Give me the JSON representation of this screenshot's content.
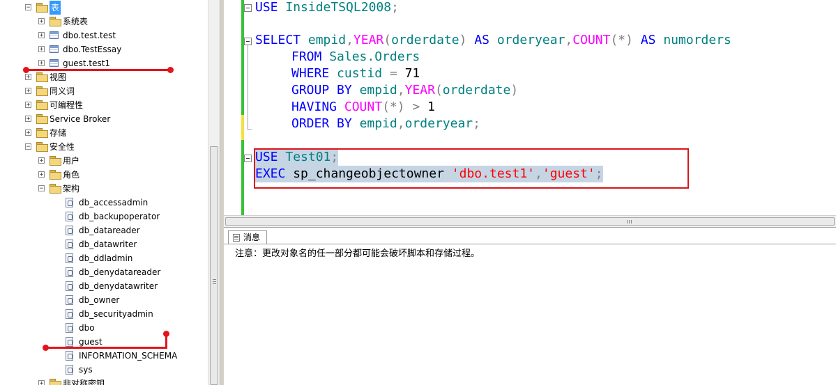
{
  "tree": {
    "items": [
      {
        "label": "表",
        "icon": "folder-icon",
        "expander": "−",
        "selected": true
      },
      {
        "label": "系统表",
        "icon": "folder-icon",
        "expander": "+"
      },
      {
        "label": "dbo.test.test",
        "icon": "table-icon",
        "expander": "+"
      },
      {
        "label": "dbo.TestEssay",
        "icon": "table-icon",
        "expander": "+"
      },
      {
        "label": "guest.test1",
        "icon": "table-icon",
        "expander": "+"
      },
      {
        "label": "视图",
        "icon": "folder-icon",
        "expander": "+"
      },
      {
        "label": "同义词",
        "icon": "folder-icon",
        "expander": "+"
      },
      {
        "label": "可编程性",
        "icon": "folder-icon",
        "expander": "+"
      },
      {
        "label": "Service Broker",
        "icon": "folder-icon",
        "expander": "+"
      },
      {
        "label": "存储",
        "icon": "folder-icon",
        "expander": "+"
      },
      {
        "label": "安全性",
        "icon": "folder-icon",
        "expander": "−"
      },
      {
        "label": "用户",
        "icon": "folder-icon",
        "expander": "+"
      },
      {
        "label": "角色",
        "icon": "folder-icon",
        "expander": "+"
      },
      {
        "label": "架构",
        "icon": "folder-icon",
        "expander": "−"
      },
      {
        "label": "db_accessadmin",
        "icon": "schema-icon"
      },
      {
        "label": "db_backupoperator",
        "icon": "schema-icon"
      },
      {
        "label": "db_datareader",
        "icon": "schema-icon"
      },
      {
        "label": "db_datawriter",
        "icon": "schema-icon"
      },
      {
        "label": "db_ddladmin",
        "icon": "schema-icon"
      },
      {
        "label": "db_denydatareader",
        "icon": "schema-icon"
      },
      {
        "label": "db_denydatawriter",
        "icon": "schema-icon"
      },
      {
        "label": "db_owner",
        "icon": "schema-icon"
      },
      {
        "label": "db_securityadmin",
        "icon": "schema-icon"
      },
      {
        "label": "dbo",
        "icon": "schema-icon"
      },
      {
        "label": "guest",
        "icon": "schema-icon"
      },
      {
        "label": "INFORMATION_SCHEMA",
        "icon": "schema-icon"
      },
      {
        "label": "sys",
        "icon": "schema-icon"
      },
      {
        "label": "非对称密钥",
        "icon": "folder-icon",
        "expander": "+"
      }
    ]
  },
  "editor": {
    "line1": {
      "kw": "USE",
      "db": "InsideTSQL2008",
      "end": ";"
    },
    "line2": {
      "select": "SELECT",
      "c1": "empid",
      "comma": ",",
      "year": "YEAR",
      "lp": "(",
      "c2": "orderdate",
      "rp": ")",
      "as": "AS",
      "a1": "orderyear",
      "count": "COUNT",
      "star": "(*)",
      "a2": "numorders"
    },
    "line3": {
      "from": "FROM",
      "table": "Sales.Orders"
    },
    "line4": {
      "where": "WHERE",
      "col": "custid",
      "eq": "=",
      "val": "71"
    },
    "line5": {
      "group": "GROUP",
      "by": "BY",
      "c1": "empid",
      "comma": ",",
      "year": "YEAR",
      "lp": "(",
      "c2": "orderdate",
      "rp": ")"
    },
    "line6": {
      "having": "HAVING",
      "count": "COUNT",
      "star": "(*)",
      "gt": ">",
      "val": "1"
    },
    "line7": {
      "order": "ORDER",
      "by": "BY",
      "c1": "empid",
      "comma": ",",
      "c2": "orderyear",
      "end": ";"
    },
    "line8": {
      "kw": "USE",
      "db": "Test01",
      "end": ";"
    },
    "line9": {
      "exec": "EXEC",
      "proc": "sp_changeobjectowner",
      "arg1": "'dbo.test1'",
      "comma": ",",
      "arg2": "'guest'",
      "end": ";"
    }
  },
  "results": {
    "tab_label": "消息",
    "message": "注意：更改对象名的任一部分都可能会破坏脚本和存储过程。"
  },
  "colors": {
    "keyword": "#0000ff",
    "function": "#ff00ff",
    "identifier": "#008080",
    "string": "#ff0000",
    "annotation": "#e3141b"
  }
}
